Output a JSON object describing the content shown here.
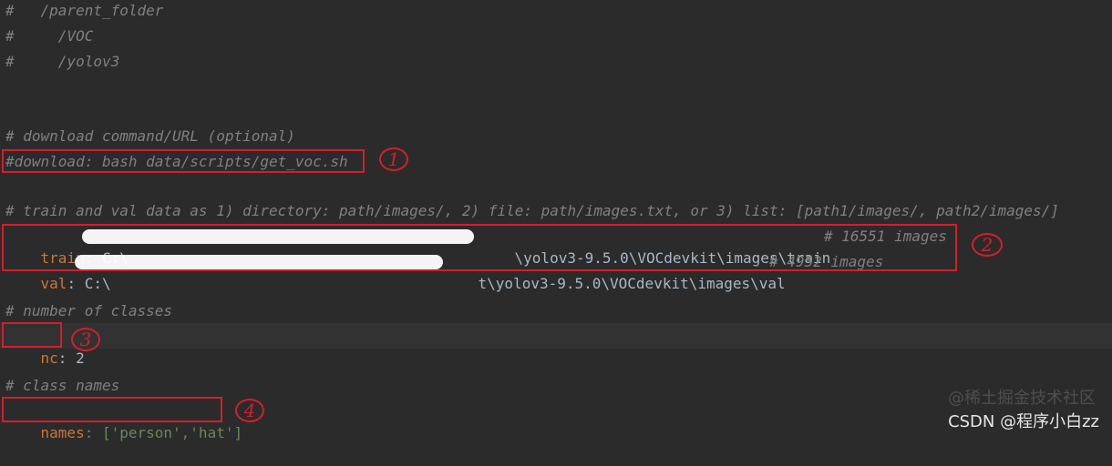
{
  "editor": {
    "line1": "#   /parent_folder",
    "line2": "#     /VOC",
    "line3": "#     /yolov3",
    "download_comment": "# download command/URL (optional)",
    "download_line": "#download: bash data/scripts/get_voc.sh",
    "data_comment": "# train and val data as 1) directory: path/images/, 2) file: path/images.txt, or 3) list: [path1/images/, path2/images/]",
    "train_key": "train",
    "train_prefix": ": C:\\",
    "train_suffix": "\\yolov3-9.5.0\\VOCdevkit\\images\\train",
    "train_comment": "# 16551 images",
    "val_key": "val",
    "val_prefix": ": C:\\",
    "val_suffix": "t\\yolov3-9.5.0\\VOCdevkit\\images\\val",
    "val_comment": "# 4952 images",
    "nc_comment": "# number of classes",
    "nc_key": "nc",
    "nc_value": ": 2",
    "names_comment": "# class names",
    "names_key": "names",
    "names_value": ": ['person','hat']"
  },
  "annotations": [
    "1",
    "2",
    "3",
    "4"
  ],
  "watermark": {
    "primary": "CSDN @程序小白zz",
    "secondary": "@稀土掘金技术社区"
  },
  "colors": {
    "background": "#2b2b2b",
    "comment": "#808080",
    "keyword": "#cc7832",
    "annotation": "#d21f2c"
  }
}
